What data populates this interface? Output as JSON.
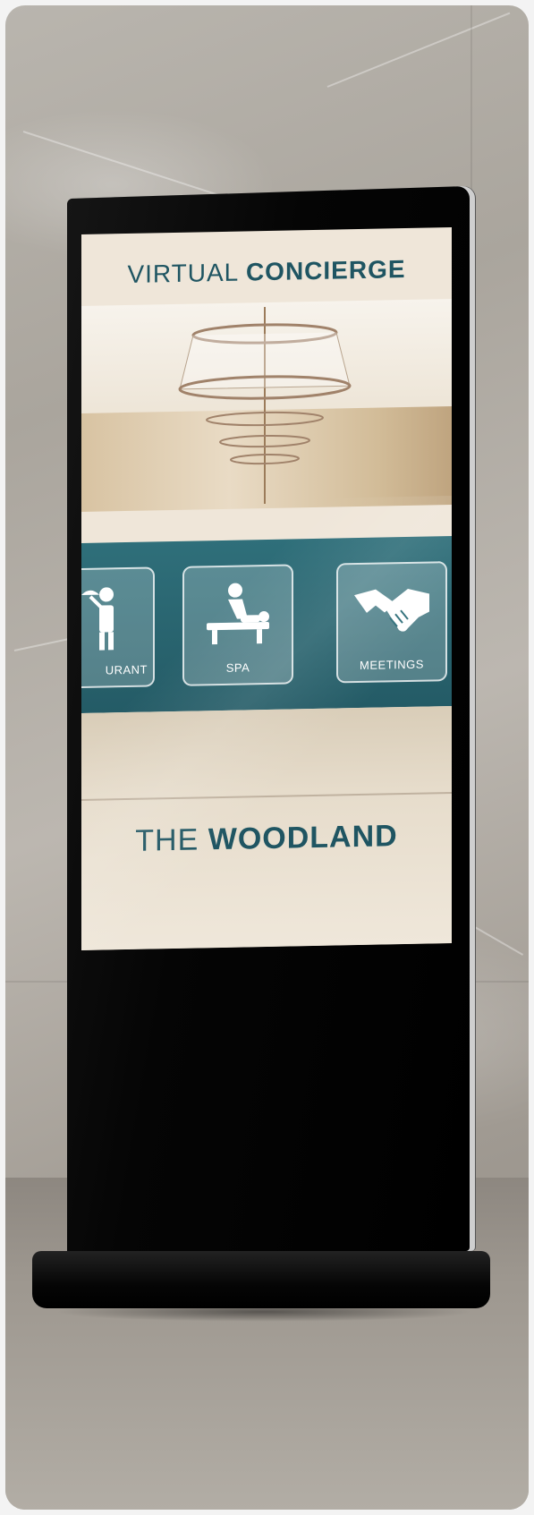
{
  "screen": {
    "title_light": "VIRTUAL",
    "title_bold": "CONCIERGE",
    "footer_light": "THE",
    "footer_bold": "WOODLAND",
    "tiles": [
      {
        "label": "URANT",
        "icon": "waiter-icon"
      },
      {
        "label": "SPA",
        "icon": "massage-icon"
      },
      {
        "label": "MEETINGS",
        "icon": "handshake-icon"
      }
    ]
  },
  "colors": {
    "brand_teal": "#1f5562",
    "band_teal": "#2f6f7a",
    "kiosk_black": "#000000"
  }
}
